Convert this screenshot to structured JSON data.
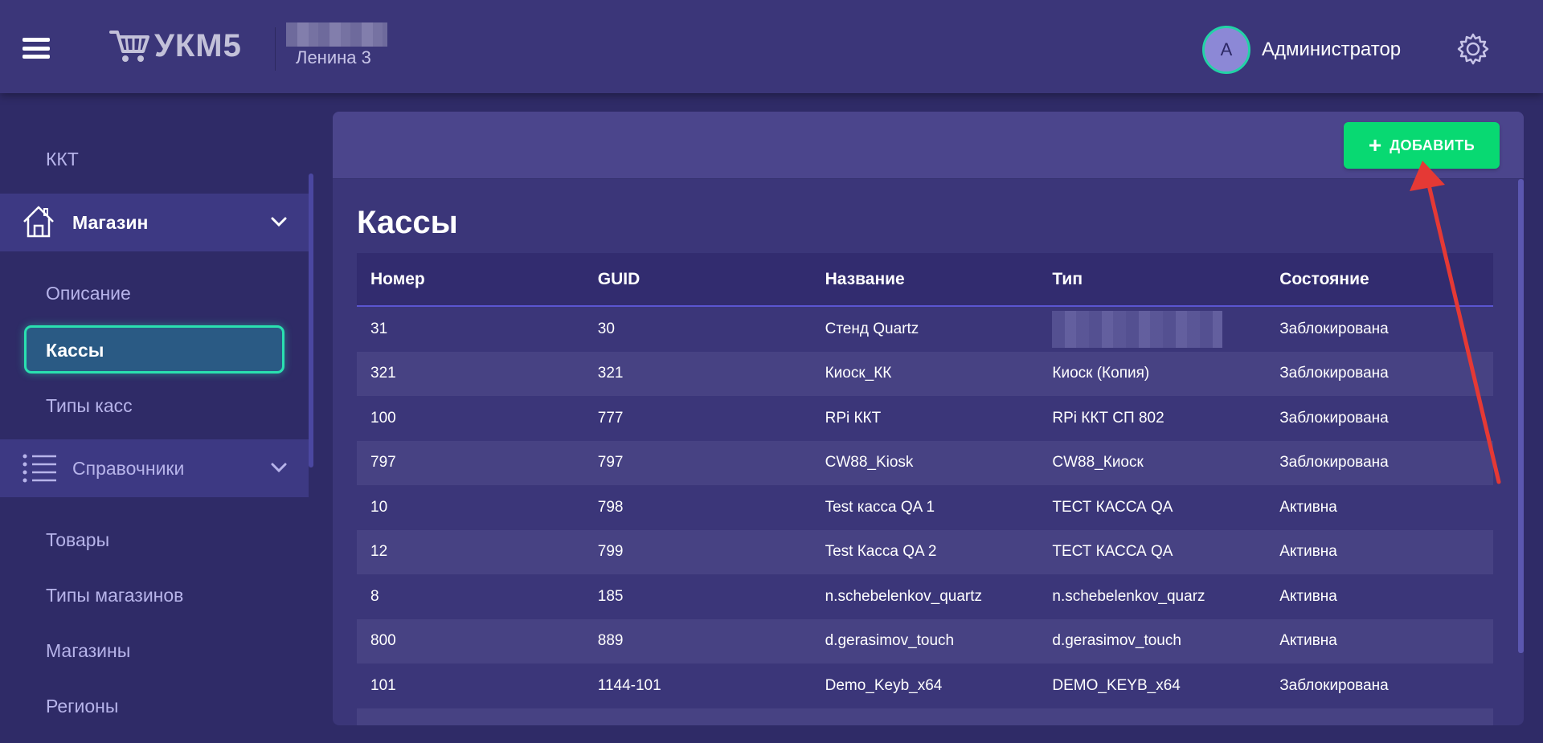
{
  "header": {
    "logo_text": "УКМ5",
    "store_name": "Ленина 3",
    "avatar_letter": "А",
    "user_name": "Администратор"
  },
  "sidebar": {
    "top_link": "ККТ",
    "group_store": "Магазин",
    "store_items": [
      "Описание",
      "Кассы",
      "Типы касс"
    ],
    "group_refs": "Справочники",
    "ref_items": [
      "Товары",
      "Типы магазинов",
      "Магазины",
      "Регионы"
    ]
  },
  "toolbar": {
    "add_label": "ДОБАВИТЬ"
  },
  "main": {
    "title": "Кассы",
    "columns": [
      "Номер",
      "GUID",
      "Название",
      "Тип",
      "Состояние"
    ],
    "rows": [
      [
        "31",
        "30",
        "Стенд Quartz",
        "",
        "Заблокирована"
      ],
      [
        "321",
        "321",
        "Киоск_КК",
        "Киоск (Копия)",
        "Заблокирована"
      ],
      [
        "100",
        "777",
        "RPi ККТ",
        "RPi ККТ СП 802",
        "Заблокирована"
      ],
      [
        "797",
        "797",
        "CW88_Kiosk",
        "CW88_Киоск",
        "Заблокирована"
      ],
      [
        "10",
        "798",
        "Test касса QA 1",
        "ТЕСТ КАССА QA",
        "Активна"
      ],
      [
        "12",
        "799",
        "Test Касса QA 2",
        "ТЕСТ КАССА QA",
        "Активна"
      ],
      [
        "8",
        "185",
        "n.schebelenkov_quartz",
        "n.schebelenkov_quarz",
        "Активна"
      ],
      [
        "800",
        "889",
        "d.gerasimov_touch",
        "d.gerasimov_touch",
        "Активна"
      ],
      [
        "101",
        "1144-101",
        "Demo_Keyb_x64",
        "DEMO_KEYB_x64",
        "Заблокирована"
      ]
    ]
  },
  "colors": {
    "header_bg": "#3b3679",
    "page_bg": "#2f2b67",
    "accent_green": "#08d972",
    "active_border": "#2ae0b0",
    "annotation_arrow": "#e53935"
  }
}
